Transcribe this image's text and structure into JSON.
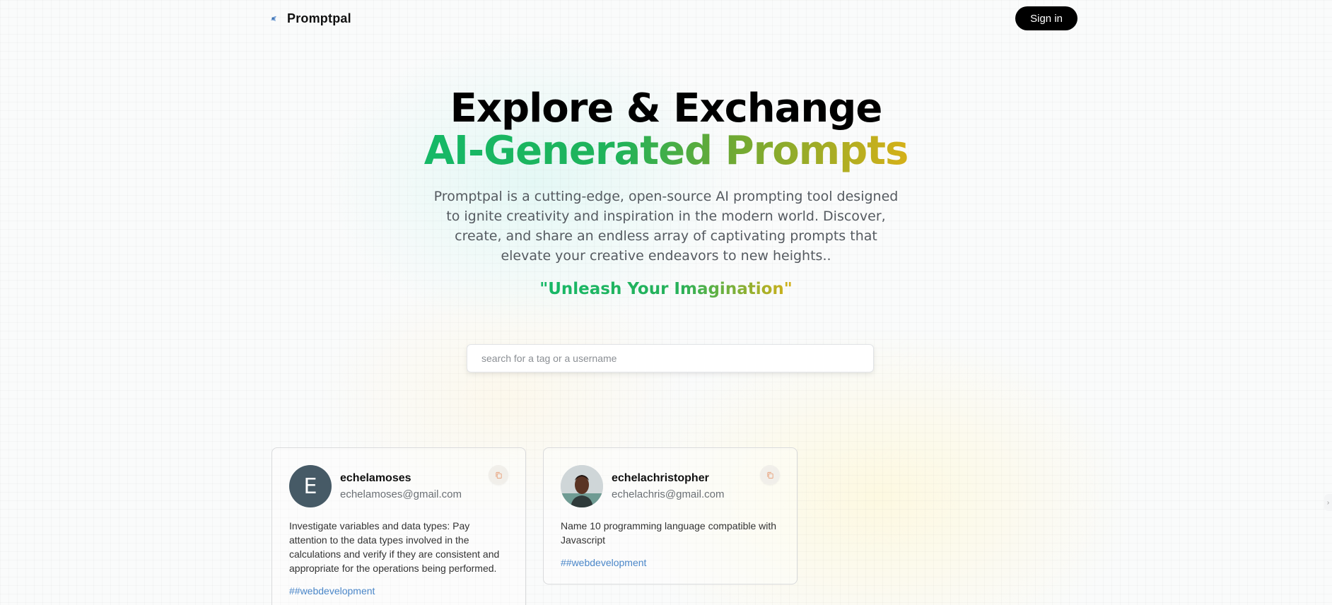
{
  "nav": {
    "brand": "Promptpal",
    "signin_label": "Sign in"
  },
  "hero": {
    "title_line1": "Explore & Exchange",
    "title_line2": "AI-Generated Prompts",
    "description": "Promptpal is a cutting-edge, open-source AI prompting tool designed to ignite creativity and inspiration in the modern world. Discover, create, and share an endless array of captivating prompts that elevate your creative endeavors to new heights..",
    "tagline": "\"Unleash Your Imagination\""
  },
  "search": {
    "placeholder": "search for a tag or a username",
    "value": ""
  },
  "prompts": [
    {
      "avatar_letter": "E",
      "username": "echelamoses",
      "email": "echelamoses@gmail.com",
      "prompt": "Investigate variables and data types: Pay attention to the data types involved in the calculations and verify if they are consistent and appropriate for the operations being performed.",
      "tag": "##webdevelopment"
    },
    {
      "avatar_letter": "",
      "username": "echelachristopher",
      "email": "echelachris@gmail.com",
      "prompt": "Name 10 programming language compatible with Javascript",
      "tag": "##webdevelopment"
    }
  ],
  "colors": {
    "gradient_green": "#16b867",
    "gradient_gold": "#d5b018",
    "tag_blue": "#4a86c8",
    "avatar_bg": "#465a66",
    "signin_bg": "#000000"
  },
  "icons": [
    "logo-icon",
    "copy-icon",
    "chevron-right-icon"
  ]
}
